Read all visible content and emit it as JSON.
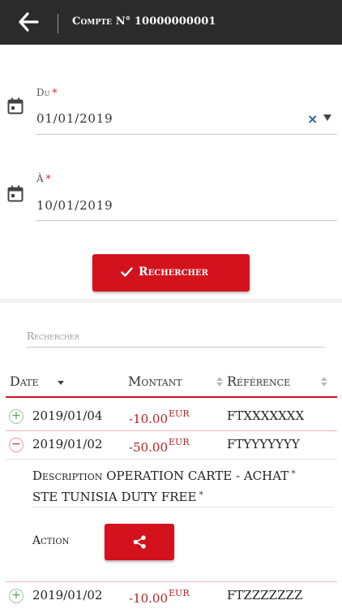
{
  "header": {
    "title": "Compte N° 10000000001"
  },
  "form": {
    "from": {
      "label": "Du",
      "required_mark": "*",
      "value": "01/01/2019"
    },
    "to": {
      "label": "À",
      "required_mark": "*",
      "value": "10/01/2019"
    },
    "clear_symbol": "×",
    "search_button": "Rechercher"
  },
  "results": {
    "filter_placeholder": "Rechercher",
    "columns": [
      "Date",
      "Montant",
      "Référence"
    ],
    "rows": [
      {
        "toggle": "+",
        "date": "2019/01/04",
        "amount": "-10.00",
        "currency": "EUR",
        "reference": "FTXXXXXXX"
      },
      {
        "toggle": "−",
        "date": "2019/01/02",
        "amount": "-50.00",
        "currency": "EUR",
        "reference": "FTYYYYYYY"
      },
      {
        "toggle": "+",
        "date": "2019/01/02",
        "amount": "-10.00",
        "currency": "EUR",
        "reference": "FTZZZZZZZ"
      }
    ],
    "detail": {
      "description_label": "Description",
      "description_value": "OPERATION CARTE - ACHAT",
      "description_mark": "*",
      "description_value_2": "STE TUNISIA DUTY FREE",
      "description_mark_2": "*",
      "action_label": "Action"
    }
  },
  "colors": {
    "topbar": "#2b2b2b",
    "accent": "#d3121e",
    "amount": "#b22222",
    "clear_icon": "#2b5ea0"
  },
  "icons": [
    "back-arrow-icon",
    "calendar-icon",
    "clear-icon",
    "dropdown-caret-icon",
    "check-icon",
    "sort-icon",
    "expand-icon",
    "collapse-icon",
    "share-icon"
  ]
}
